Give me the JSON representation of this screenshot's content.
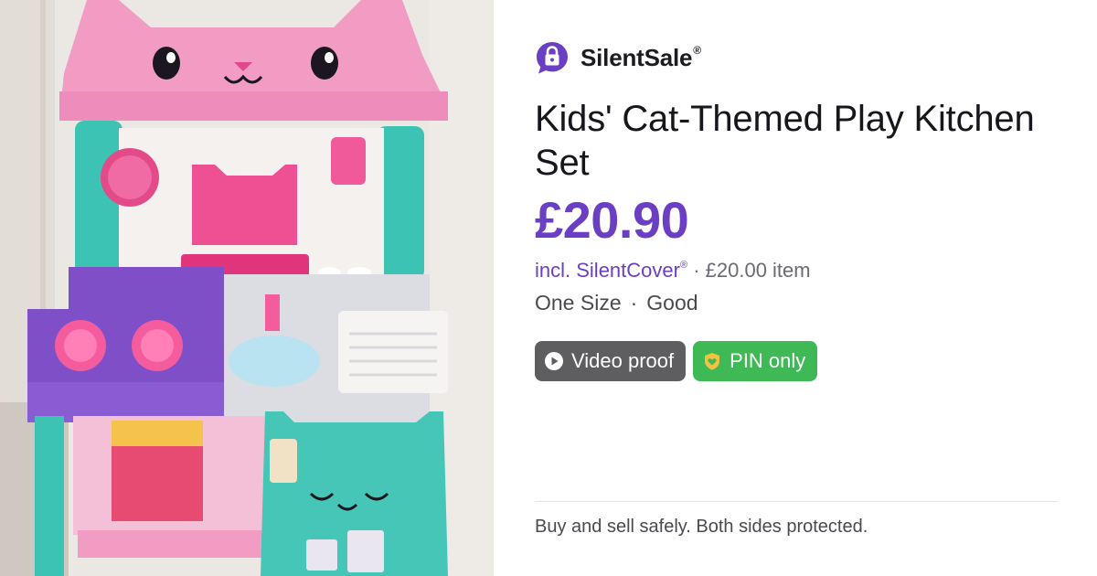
{
  "brand": {
    "name": "SilentSale",
    "reg": "®",
    "logo_icon": "padlock-speech-bubble-icon",
    "color": "#6b3fc4"
  },
  "listing": {
    "title": "Kids' Cat-Themed Play Kitchen Set",
    "price": "£20.90",
    "incl_prefix": "incl.",
    "cover_name": "SilentCover",
    "cover_reg": "®",
    "item_price_text": "· £20.00 item",
    "size": "One Size",
    "separator": "·",
    "condition": "Good"
  },
  "badges": {
    "video": {
      "label": "Video proof",
      "icon": "play-circle-icon",
      "color": "#5e5e60"
    },
    "pin": {
      "label": "PIN only",
      "icon": "heart-shield-icon",
      "color": "#3eb955"
    }
  },
  "footer": {
    "text": "Buy and sell safely. Both sides protected."
  }
}
